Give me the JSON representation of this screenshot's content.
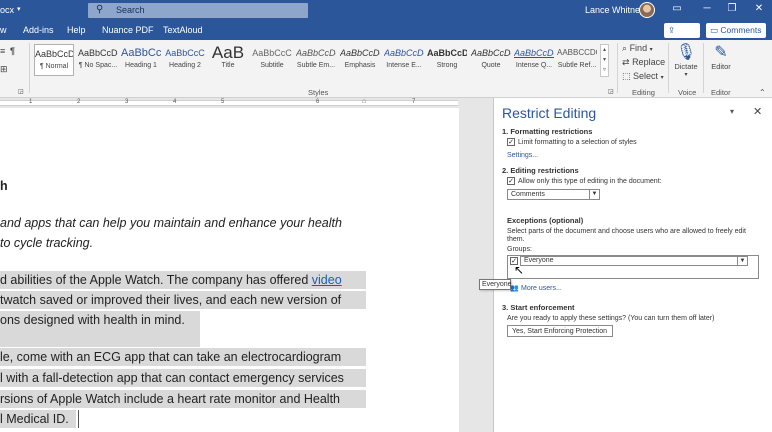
{
  "titlebar": {
    "doc_name": "ocx",
    "search_placeholder": "Search",
    "user_name": "Lance Whitney",
    "btn_ribbon": "▭",
    "btn_min": "─",
    "btn_max": "❐",
    "btn_close": "✕"
  },
  "menu": {
    "items": [
      "w",
      "Add-ins",
      "Help",
      "Nuance PDF",
      "TextAloud"
    ],
    "share": "Share",
    "comments": "Comments"
  },
  "ribbon": {
    "styles": [
      {
        "preview": "AaBbCcDc",
        "name": "¶ Normal"
      },
      {
        "preview": "AaBbCcDc",
        "name": "¶ No Spac..."
      },
      {
        "preview": "AaBbCc",
        "name": "Heading 1"
      },
      {
        "preview": "AaBbCcC",
        "name": "Heading 2"
      },
      {
        "preview": "AaB",
        "name": "Title"
      },
      {
        "preview": "AaBbCcC",
        "name": "Subtitle"
      },
      {
        "preview": "AaBbCcDc",
        "name": "Subtle Em..."
      },
      {
        "preview": "AaBbCcDc",
        "name": "Emphasis"
      },
      {
        "preview": "AaBbCcDc",
        "name": "Intense E..."
      },
      {
        "preview": "AaBbCcDc",
        "name": "Strong"
      },
      {
        "preview": "AaBbCcDc",
        "name": "Quote"
      },
      {
        "preview": "AaBbCcDc",
        "name": "Intense Q..."
      },
      {
        "preview": "AABBCCDC",
        "name": "Subtle Ref..."
      }
    ],
    "find": "Find",
    "replace": "Replace",
    "select": "Select",
    "dictate": "Dictate",
    "editor": "Editor",
    "group_styles": "Styles",
    "group_editing": "Editing",
    "group_voice": "Voice",
    "group_editor": "Editor"
  },
  "ruler": {
    "numbers": [
      "1",
      "2",
      "3",
      "4",
      "5",
      "6",
      "7"
    ]
  },
  "document": {
    "heading_frag": "h",
    "p1_l1": "and apps that can help you maintain and enhance your health",
    "p1_l2": "to cycle tracking.",
    "p2_l1_pre": "d abilities of the Apple Watch. The company has offered ",
    "p2_l1_link": "video",
    "p2_l2": "twatch saved or improved their lives, and each new version of",
    "p2_l3": "ons designed with health in mind.",
    "p3_l1": "le, come with an ECG app that can take an electrocardiogram",
    "p3_l2": "l with a fall-detection app that can contact emergency services",
    "p3_l3": "rsions of Apple Watch include a heart rate monitor and Health",
    "p3_l4": "l Medical ID."
  },
  "pane": {
    "title": "Restrict Editing",
    "sec1": "1. Formatting restrictions",
    "limit_label": "Limit formatting to a selection of styles",
    "settings_link": "Settings...",
    "sec2": "2. Editing restrictions",
    "allow_label": "Allow only this type of editing in the document:",
    "edit_type": "Comments",
    "exceptions": "Exceptions (optional)",
    "exceptions_desc_1": "Select parts of the document and choose users who are allowed to freely edit",
    "exceptions_desc_2": "them.",
    "groups_label": "Groups:",
    "group_everyone": "Everyone",
    "more_users": "More users...",
    "sec3": "3. Start enforcement",
    "ready_text": "Are you ready to apply these settings? (You can turn them off later)",
    "enforce_btn": "Yes, Start Enforcing Protection"
  },
  "tooltip": "Everyone"
}
